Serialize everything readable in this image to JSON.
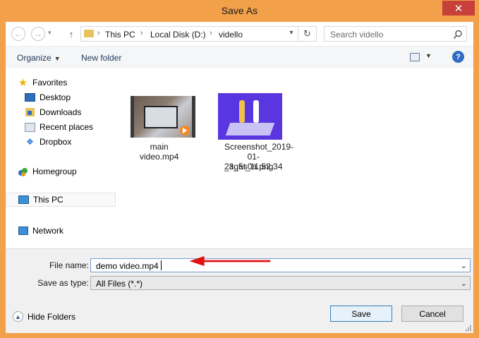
{
  "window": {
    "title": "Save As",
    "close_glyph": "✕"
  },
  "address": {
    "crumbs": [
      "This PC",
      "Local Disk (D:)",
      "vidello"
    ]
  },
  "search": {
    "placeholder": "Search vidello"
  },
  "toolbar": {
    "organize": "Organize",
    "new_folder": "New folder"
  },
  "nav": {
    "favorites": "Favorites",
    "items": [
      {
        "label": "Desktop",
        "icon": "desktop-icon"
      },
      {
        "label": "Downloads",
        "icon": "downloads-folder-icon"
      },
      {
        "label": "Recent places",
        "icon": "recent-places-icon"
      },
      {
        "label": "Dropbox",
        "icon": "dropbox-icon"
      }
    ],
    "homegroup": "Homegroup",
    "this_pc": "This PC",
    "network": "Network"
  },
  "files": [
    {
      "name": "main video.mp4",
      "icon": "video-thumbnail"
    },
    {
      "name_lines": [
        "Screenshot_2019-",
        "01-23_at_11.52.34",
        "_ag5s0a.png"
      ],
      "icon": "image-thumbnail"
    }
  ],
  "form": {
    "file_name_label": "File name:",
    "file_name_value": "demo video.mp4",
    "save_as_type_label": "Save as type:",
    "save_as_type_value": "All Files (*.*)"
  },
  "footer": {
    "hide_folders": "Hide Folders",
    "save": "Save",
    "cancel": "Cancel"
  },
  "colors": {
    "titlebar": "#f2a04a",
    "close": "#c7403a",
    "arrow": "#e01010",
    "accent": "#2f6cc5"
  }
}
